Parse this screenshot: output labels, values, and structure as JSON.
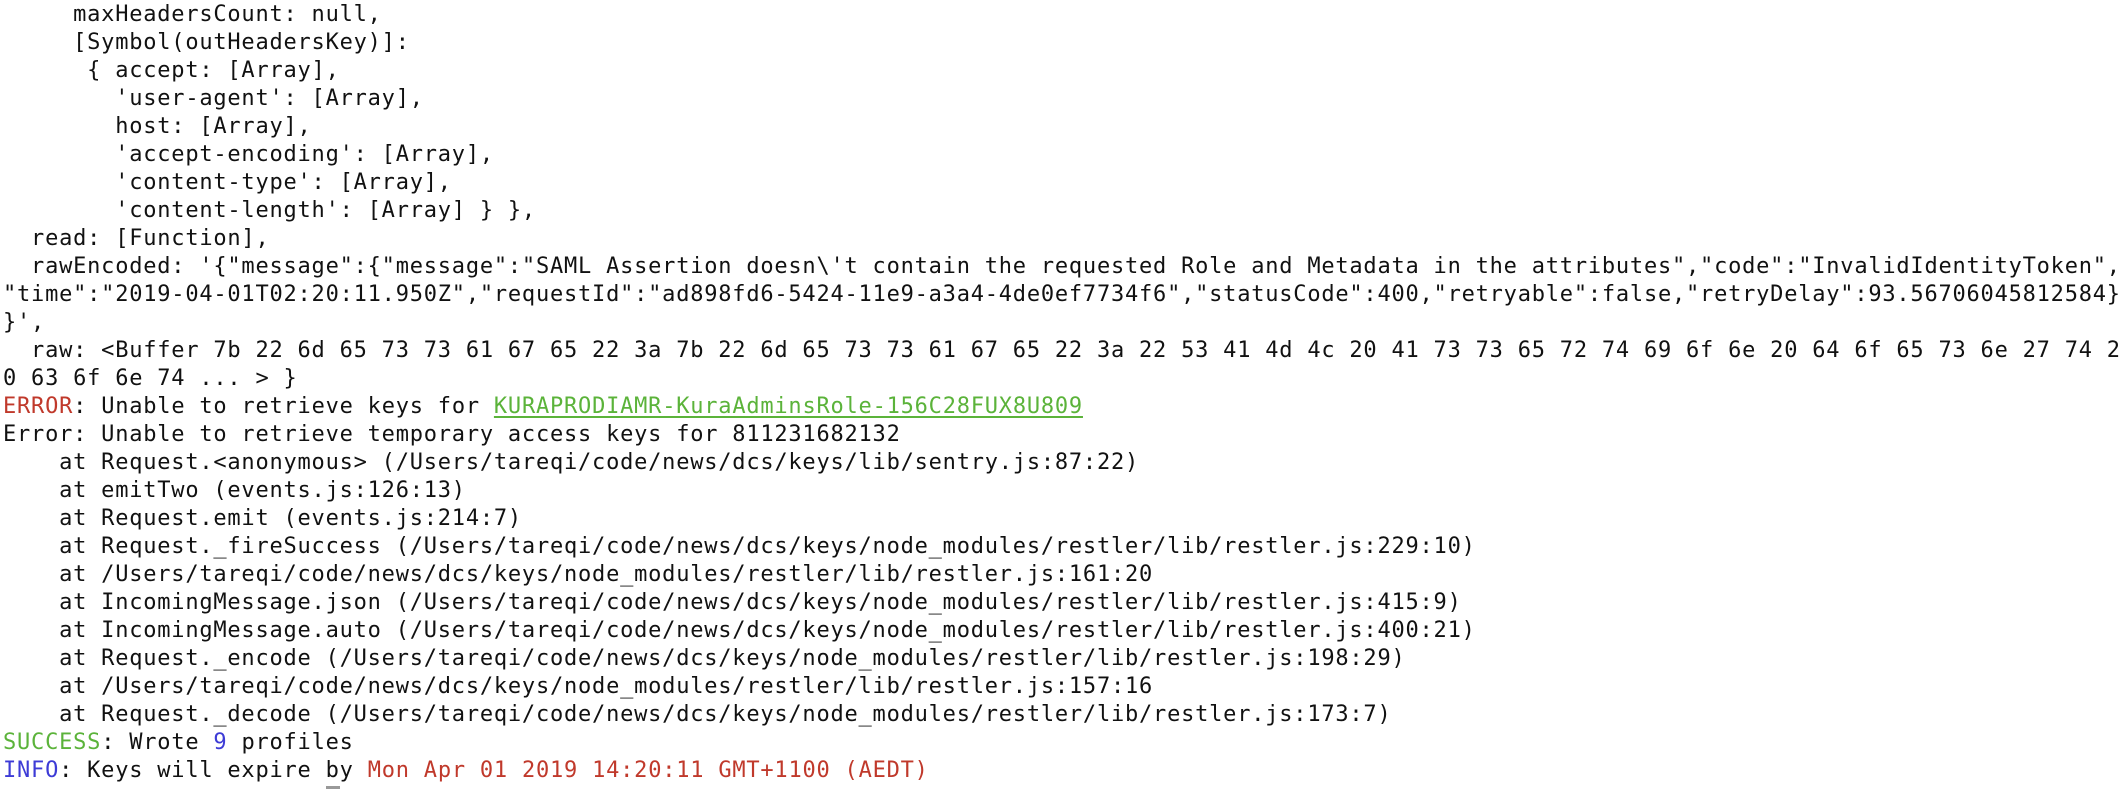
{
  "colors": {
    "error": "#c0392b",
    "success": "#5bb33a",
    "info": "#3d3bd6",
    "link": "#5bb33a",
    "text": "#111111",
    "background": "#ffffff"
  },
  "terminal": {
    "lines": [
      [
        {
          "text": "     maxHeadersCount: null,"
        }
      ],
      [
        {
          "text": "     [Symbol(outHeadersKey)]:"
        }
      ],
      [
        {
          "text": "      { accept: [Array],"
        }
      ],
      [
        {
          "text": "        'user-agent': [Array],"
        }
      ],
      [
        {
          "text": "        host: [Array],"
        }
      ],
      [
        {
          "text": "        'accept-encoding': [Array],"
        }
      ],
      [
        {
          "text": "        'content-type': [Array],"
        }
      ],
      [
        {
          "text": "        'content-length': [Array] } },"
        }
      ],
      [
        {
          "text": "  read: [Function],"
        }
      ],
      [
        {
          "text": "  rawEncoded: '{\"message\":{\"message\":\"SAML Assertion doesn\\'t contain the requested Role and Metadata in the attributes\",\"code\":\"InvalidIdentityToken\","
        }
      ],
      [
        {
          "text": "\"time\":\"2019-04-01T02:20:11.950Z\",\"requestId\":\"ad898fd6-5424-11e9-a3a4-4de0ef7734f6\",\"statusCode\":400,\"retryable\":false,\"retryDelay\":93.56706045812584}"
        }
      ],
      [
        {
          "text": "}',"
        }
      ],
      [
        {
          "text": "  raw: <Buffer 7b 22 6d 65 73 73 61 67 65 22 3a 7b 22 6d 65 73 73 61 67 65 22 3a 22 53 41 4d 4c 20 41 73 73 65 72 74 69 6f 6e 20 64 6f 65 73 6e 27 74 2"
        }
      ],
      [
        {
          "text": "0 63 6f 6e 74 ... > }"
        }
      ],
      [
        {
          "text": "ERROR",
          "style": "error"
        },
        {
          "text": ": Unable to retrieve keys for "
        },
        {
          "text": "KURAPRODIAMR-KuraAdminsRole-156C28FUX8U809",
          "style": "link"
        }
      ],
      [
        {
          "text": "Error: Unable to retrieve temporary access keys for 811231682132"
        }
      ],
      [
        {
          "text": "    at Request.<anonymous> (/Users/tareqi/code/news/dcs/keys/lib/sentry.js:87:22)"
        }
      ],
      [
        {
          "text": "    at emitTwo (events.js:126:13)"
        }
      ],
      [
        {
          "text": "    at Request.emit (events.js:214:7)"
        }
      ],
      [
        {
          "text": "    at Request._fireSuccess (/Users/tareqi/code/news/dcs/keys/node_modules/restler/lib/restler.js:229:10)"
        }
      ],
      [
        {
          "text": "    at /Users/tareqi/code/news/dcs/keys/node_modules/restler/lib/restler.js:161:20"
        }
      ],
      [
        {
          "text": "    at IncomingMessage.json (/Users/tareqi/code/news/dcs/keys/node_modules/restler/lib/restler.js:415:9)"
        }
      ],
      [
        {
          "text": "    at IncomingMessage.auto (/Users/tareqi/code/news/dcs/keys/node_modules/restler/lib/restler.js:400:21)"
        }
      ],
      [
        {
          "text": "    at Request._encode (/Users/tareqi/code/news/dcs/keys/node_modules/restler/lib/restler.js:198:29)"
        }
      ],
      [
        {
          "text": "    at /Users/tareqi/code/news/dcs/keys/node_modules/restler/lib/restler.js:157:16"
        }
      ],
      [
        {
          "text": "    at Request._decode (/Users/tareqi/code/news/dcs/keys/node_modules/restler/lib/restler.js:173:7)"
        }
      ],
      [
        {
          "text": "SUCCESS",
          "style": "success"
        },
        {
          "text": ": Wrote "
        },
        {
          "text": "9",
          "style": "num"
        },
        {
          "text": " profiles"
        }
      ],
      [
        {
          "text": "INFO",
          "style": "info"
        },
        {
          "text": ": Keys will expire "
        },
        {
          "text": "b",
          "style": "cursor"
        },
        {
          "text": "y "
        },
        {
          "text": "Mon Apr 01 2019 14:20:11 GMT+1100 (AEDT)",
          "style": "date"
        }
      ]
    ]
  }
}
